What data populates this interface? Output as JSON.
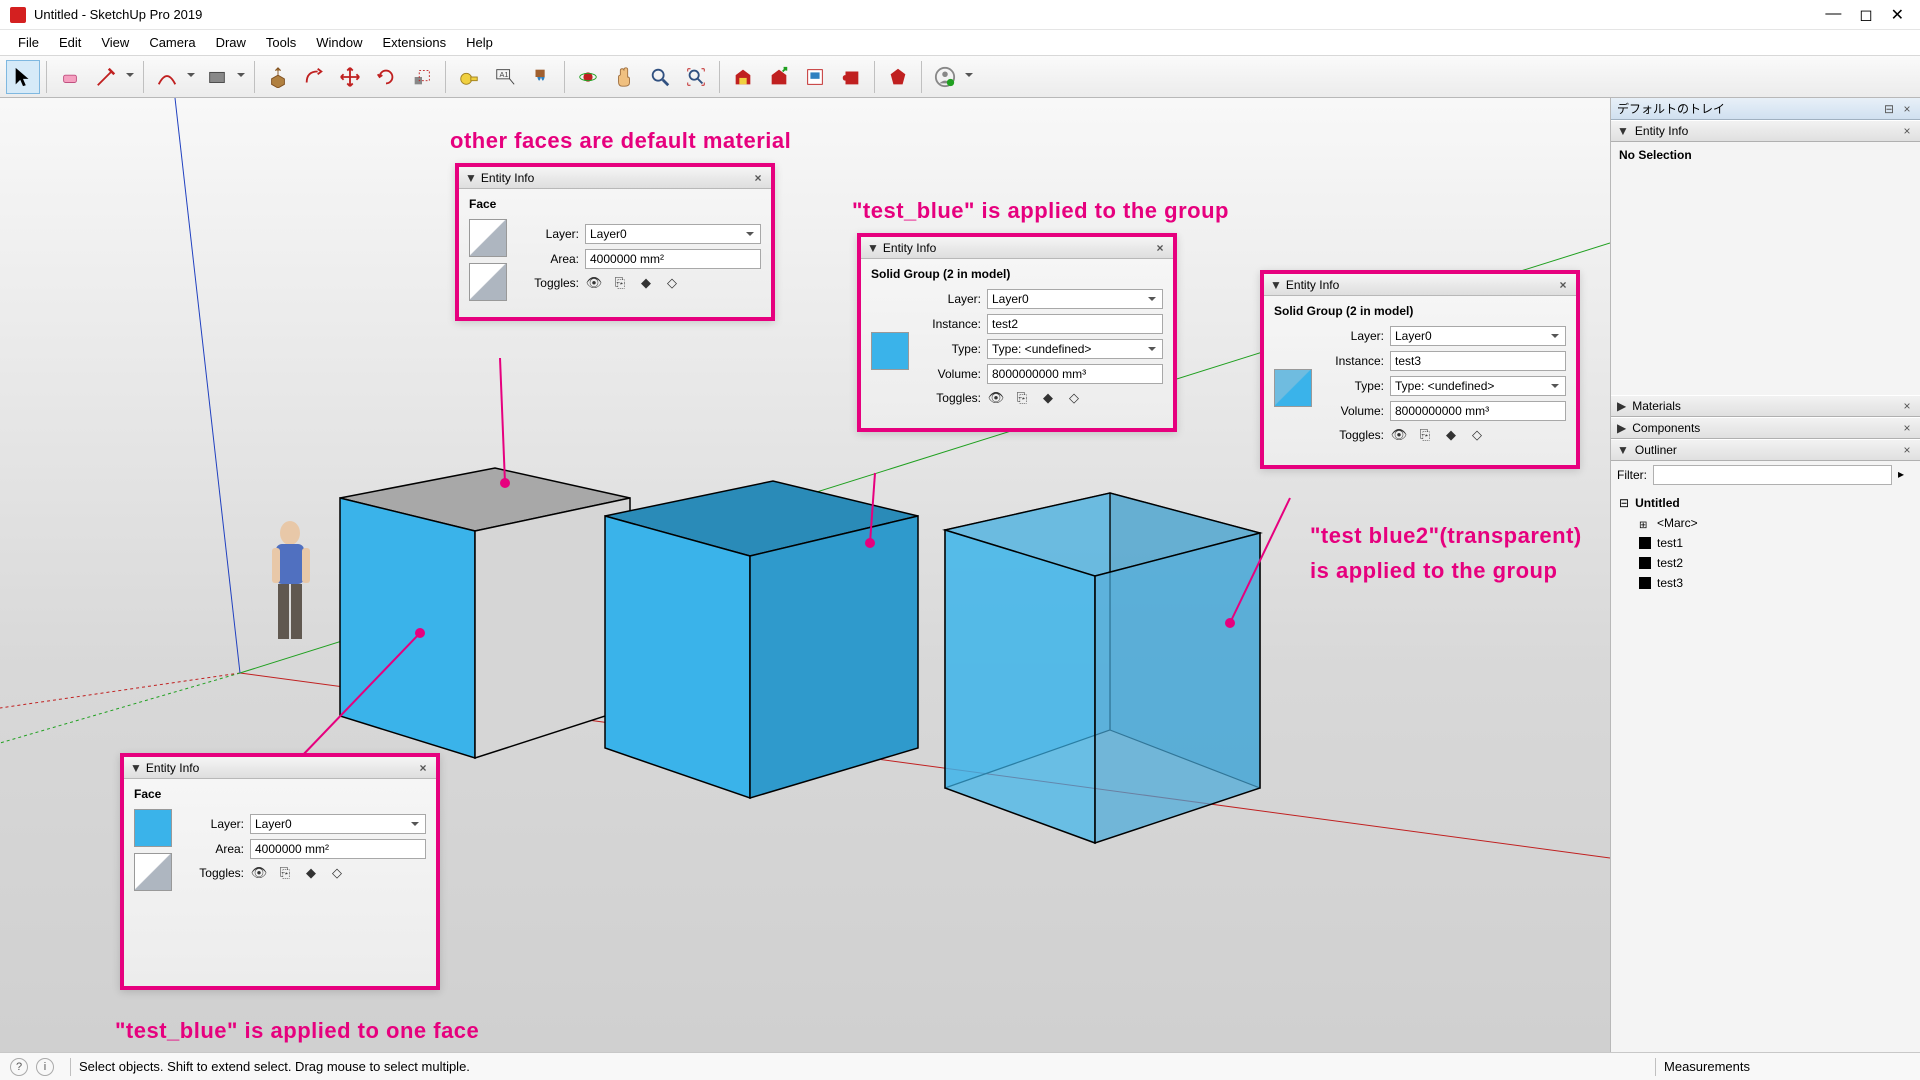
{
  "app": {
    "title": "Untitled - SketchUp Pro 2019"
  },
  "menu": [
    "File",
    "Edit",
    "View",
    "Camera",
    "Draw",
    "Tools",
    "Window",
    "Extensions",
    "Help"
  ],
  "tray": {
    "title": "デフォルトのトレイ",
    "entity_info_title": "Entity Info",
    "no_selection": "No Selection",
    "materials_title": "Materials",
    "components_title": "Components",
    "outliner_title": "Outliner",
    "filter_label": "Filter:",
    "tree_root": "Untitled",
    "tree_items": [
      "<Marc>",
      "test1",
      "test2",
      "test3"
    ]
  },
  "panels": {
    "p1": {
      "title": "Entity Info",
      "type": "Face",
      "layer": "Layer0",
      "area": "4000000 mm²",
      "toggles_label": "Toggles:"
    },
    "p2": {
      "title": "Entity Info",
      "type": "Face",
      "layer": "Layer0",
      "area": "4000000 mm²",
      "toggles_label": "Toggles:"
    },
    "p3": {
      "title": "Entity Info",
      "type": "Solid Group (2 in model)",
      "layer": "Layer0",
      "instance": "test2",
      "type_val": "Type: <undefined>",
      "volume": "8000000000 mm³",
      "toggles_label": "Toggles:"
    },
    "p4": {
      "title": "Entity Info",
      "type": "Solid Group (2 in model)",
      "layer": "Layer0",
      "instance": "test3",
      "type_val": "Type: <undefined>",
      "volume": "8000000000 mm³",
      "toggles_label": "Toggles:"
    },
    "labels": {
      "layer": "Layer:",
      "area": "Area:",
      "instance": "Instance:",
      "type": "Type:",
      "volume": "Volume:"
    }
  },
  "annotations": {
    "a1": "other faces are default material",
    "a2": "\"test_blue\" is applied to the group",
    "a3": "\"test blue2\"(transparent)",
    "a3b": "is applied to the group",
    "a4": "\"test_blue\" is applied to one face"
  },
  "status": {
    "hint": "Select objects. Shift to extend select. Drag mouse to select multiple.",
    "measurements": "Measurements"
  }
}
